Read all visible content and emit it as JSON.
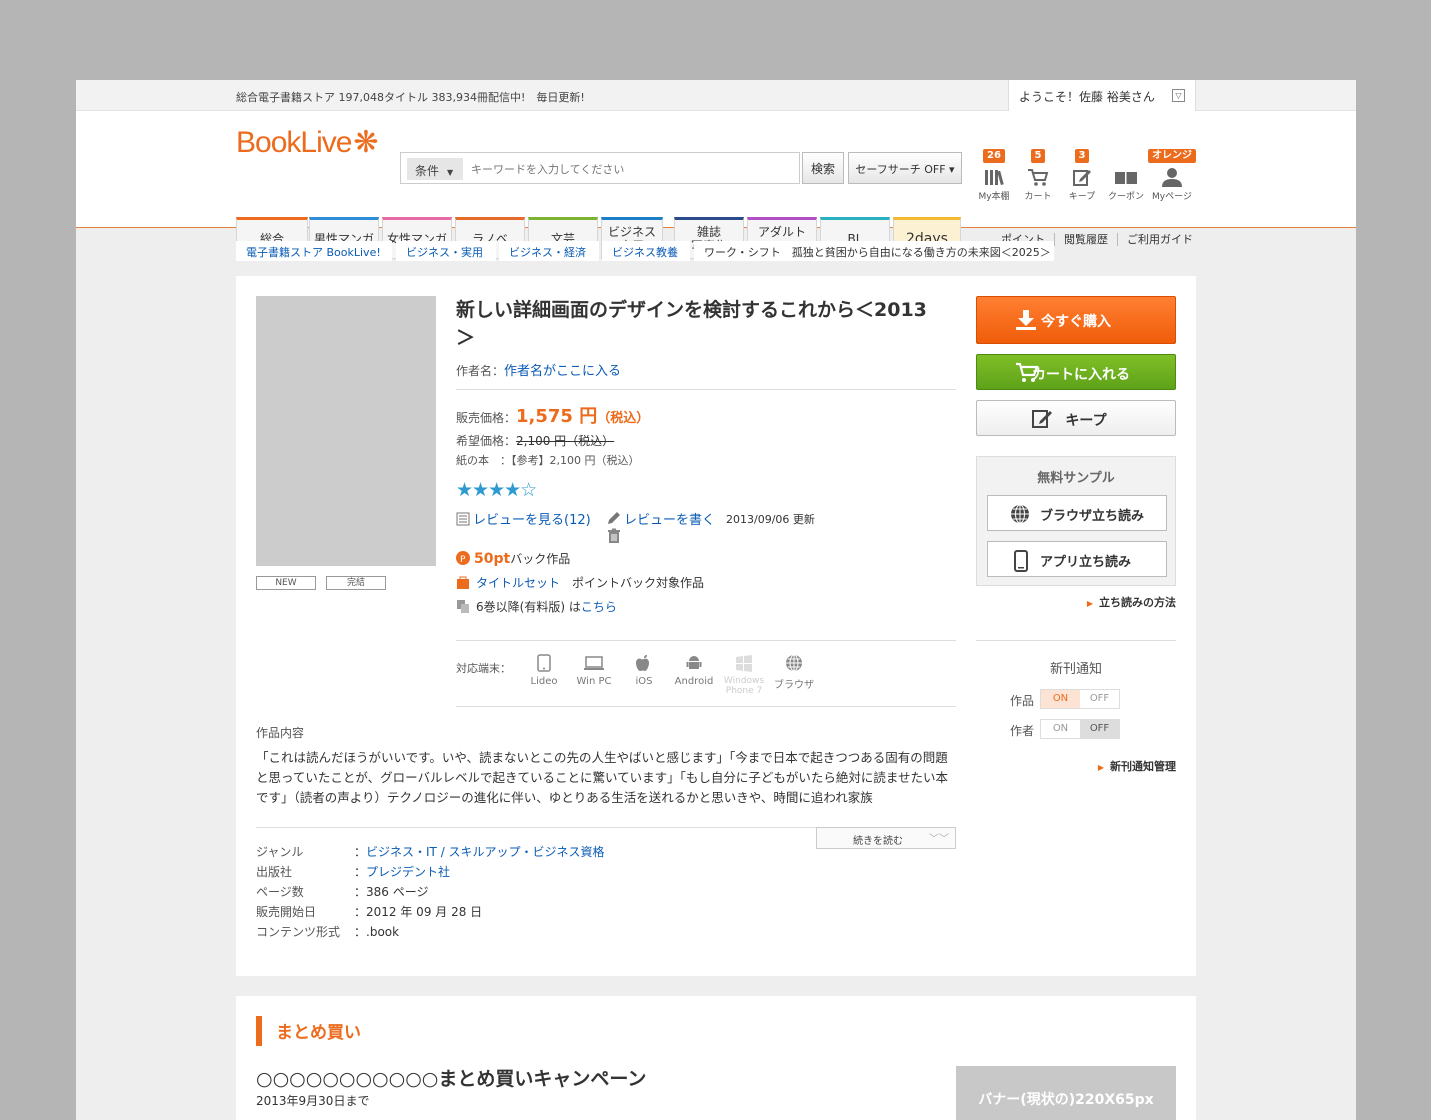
{
  "topbar": {
    "tagline": "総合電子書籍ストア 197,048タイトル 383,934冊配信中!　毎日更新!",
    "welcome": "ようこそ！佐藤 裕美さん",
    "welcome_dropdown": "▽"
  },
  "header": {
    "logo_text": "BookLive",
    "logo_spark": "❋",
    "search": {
      "condition_label": "条件",
      "condition_caret": "▼",
      "placeholder": "キーワードを入力してください",
      "button": "検索",
      "safe_search": "セーフサーチ OFF ▾"
    },
    "icons": [
      {
        "badge": "26",
        "label": "My本棚",
        "icon": "bookshelf-icon"
      },
      {
        "badge": "5",
        "label": "カート",
        "icon": "cart-icon"
      },
      {
        "badge": "3",
        "label": "キープ",
        "icon": "keep-icon"
      },
      {
        "badge": "",
        "label": "クーポン",
        "icon": "coupon-icon"
      },
      {
        "badge": "オレンジ",
        "label": "Myページ",
        "icon": "user-icon"
      }
    ]
  },
  "nav": {
    "tabs": [
      {
        "label": "総合",
        "color": "#ec6b1d"
      },
      {
        "label": "男性マンガ",
        "color": "#2e8fd8"
      },
      {
        "label": "女性マンガ",
        "color": "#e86aa5"
      },
      {
        "label": "ラノベ",
        "color": "#e66a2c"
      },
      {
        "label": "文芸",
        "color": "#7cb332"
      },
      {
        "label": "ビジネス\n実用",
        "color": "#1b7fc8"
      },
      {
        "label": "雑誌\n写真集",
        "color": "#2b4c8c"
      },
      {
        "label": "アダルト\nTL",
        "color": "#b14fc5"
      },
      {
        "label": "BL",
        "color": "#27b1c1"
      },
      {
        "label": "2days",
        "color": "#f4b930"
      }
    ],
    "utility": [
      "ポイント",
      "閲覧履歴",
      "ご利用ガイド"
    ]
  },
  "breadcrumb": [
    "電子書籍ストア BookLive!",
    "ビジネス・実用",
    "ビジネス・経済",
    "ビジネス教養",
    "ワーク・シフト　孤独と貧困から自由になる働き方の未来図＜2025＞"
  ],
  "book": {
    "badges": [
      "NEW",
      "完結"
    ],
    "title": "新しい詳細画面のデザインを検討するこれから＜2013＞",
    "author_label": "作者名：",
    "author": "作者名がここに入る",
    "price_label": "販売価格：",
    "price": "1,575 円",
    "price_tax": "（税込）",
    "list_price_label": "希望価格：",
    "list_price": "2,100 円（税込）",
    "paper_label": "紙の本　：",
    "paper_price": "【参考】2,100 円（税込）",
    "rating": 4,
    "rating_text": "★★★★☆",
    "review_view": "レビューを見る(12)",
    "review_write": "レビューを書く",
    "updated": "2013/09/06 更新",
    "points": "50pt",
    "points_suffix": "バック作品",
    "title_set": "タイトルセット",
    "title_set_suffix": "ポイントバック対象作品",
    "volumes_text": "6巻以降(有料版) は",
    "volumes_link": "こちら",
    "devices_label": "対応端末：",
    "devices": [
      {
        "label": "Lideo",
        "icon": "tablet-icon"
      },
      {
        "label": "Win PC",
        "icon": "laptop-icon"
      },
      {
        "label": "iOS",
        "icon": "apple-icon"
      },
      {
        "label": "Android",
        "icon": "android-icon"
      },
      {
        "label": "Windows Phone 7",
        "icon": "windows-icon"
      },
      {
        "label": "ブラウザ",
        "icon": "globe-icon"
      }
    ],
    "content_heading": "作品内容",
    "content": "「これは読んだほうがいいです。いや、読まないとこの先の人生やばいと感じます」「今まで日本で起きつつある固有の問題と思っていたことが、グローバルレベルで起きていることに驚いています」「もし自分に子どもがいたら絶対に読ませたい本です」（読者の声より）テクノロジーの進化に伴い、ゆとりある生活を送れるかと思いきや、時間に追われ家族",
    "more": "続きを読む",
    "meta": [
      {
        "key": "ジャンル",
        "value": "ビジネス・IT / スキルアップ・ビジネス資格",
        "link": true
      },
      {
        "key": "出版社",
        "value": "プレジデント社",
        "link": true
      },
      {
        "key": "ページ数",
        "value": "386 ページ",
        "link": false
      },
      {
        "key": "販売開始日",
        "value": "2012 年 09 月 28 日",
        "link": false
      },
      {
        "key": "コンテンツ形式",
        "value": ".book",
        "link": false
      }
    ]
  },
  "sidebar": {
    "buy": "今すぐ購入",
    "cart": "カートに入れる",
    "keep": "キープ",
    "sample_heading": "無料サンプル",
    "browser_read": "ブラウザ立ち読み",
    "app_read": "アプリ立ち読み",
    "howto": "立ち読みの方法",
    "notify_heading": "新刊通知",
    "notify_work": "作品",
    "notify_author": "作者",
    "on": "ON",
    "off": "OFF",
    "work_state": "ON",
    "author_state": "OFF",
    "notify_manage": "新刊通知管理"
  },
  "bulk": {
    "heading": "まとめ買い",
    "campaign": "○○○○○○○○○○○まとめ買いキャンペーン",
    "date": "2013年9月30日まで",
    "banner": "バナー(現状の)220X65px"
  },
  "colors": {
    "accent": "#ec6b1d",
    "link": "#0b5bb5",
    "green": "#6aab1f"
  }
}
